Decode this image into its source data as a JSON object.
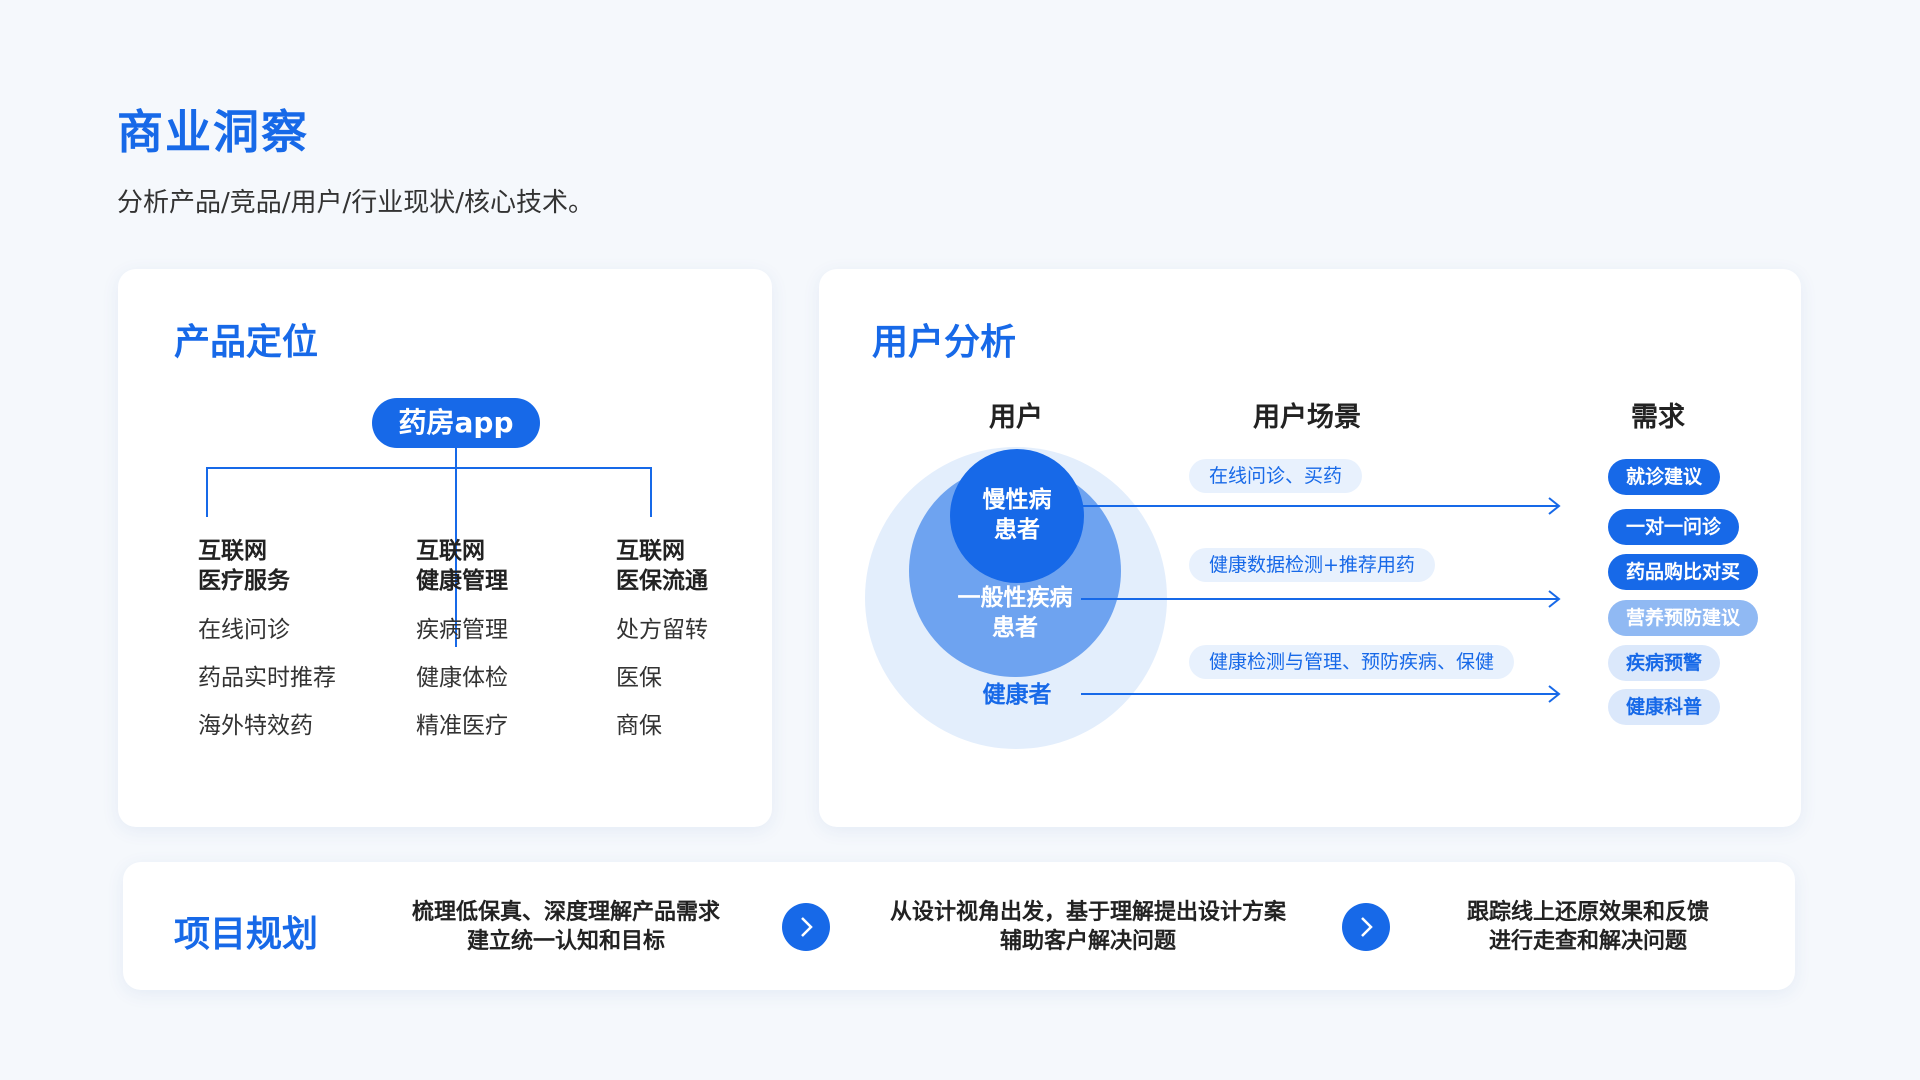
{
  "header": {
    "title": "商业洞察",
    "subtitle": "分析产品/竞品/用户/行业现状/核心技术。"
  },
  "product": {
    "title": "产品定位",
    "root": "药房app",
    "columns": [
      {
        "head1": "互联网",
        "head2": "医疗服务",
        "items": [
          "在线问诊",
          "药品实时推荐",
          "海外特效药"
        ]
      },
      {
        "head1": "互联网",
        "head2": "健康管理",
        "items": [
          "疾病管理",
          "健康体检",
          "精准医疗"
        ]
      },
      {
        "head1": "互联网",
        "head2": "医保流通",
        "items": [
          "处方留转",
          "医保",
          "商保"
        ]
      }
    ]
  },
  "user": {
    "title": "用户分析",
    "col_users": "用户",
    "col_scenes": "用户场景",
    "col_needs": "需求",
    "circles": {
      "inner": [
        "慢性病",
        "患者"
      ],
      "middle": [
        "一般性疾病",
        "患者"
      ],
      "outer": "健康者"
    },
    "scenes": [
      "在线问诊、买药",
      "健康数据检测+推荐用药",
      "健康检测与管理、预防疾病、保健"
    ],
    "needs": [
      "就诊建议",
      "一对一问诊",
      "药品购比对买",
      "营养预防建议",
      "疾病预警",
      "健康科普"
    ],
    "colors": {
      "primary": "#1769e8",
      "mid": "#6ea3f0",
      "light": "#e3eefc"
    }
  },
  "plan": {
    "title": "项目规划",
    "steps": [
      [
        "梳理低保真、深度理解产品需求",
        "建立统一认知和目标"
      ],
      [
        "从设计视角出发，基于理解提出设计方案",
        "辅助客户解决问题"
      ],
      [
        "跟踪线上还原效果和反馈",
        "进行走查和解决问题"
      ]
    ]
  }
}
